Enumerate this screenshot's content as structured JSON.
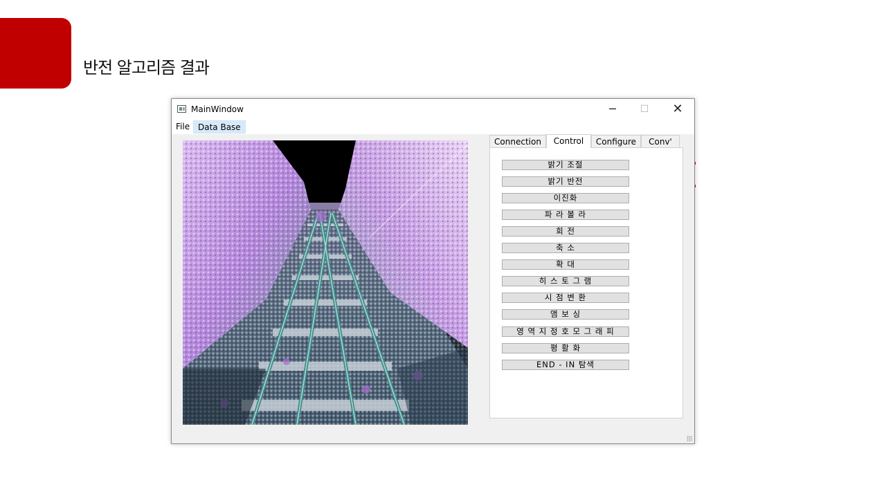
{
  "slide": {
    "title": "반전 알고리즘 결과",
    "accent_color": "#c00000"
  },
  "window": {
    "title": "MainWindow",
    "icon": "app-window-icon",
    "controls": {
      "minimize": "─",
      "maximize": "☐",
      "close": "✕"
    }
  },
  "menu": {
    "file": "File",
    "database": "Data Base"
  },
  "tabs": [
    "Connection",
    "Control",
    "Configure",
    "Conv'"
  ],
  "active_tab": "Control",
  "control_buttons": [
    "밝기 조절",
    "밝기 반전",
    "이진화",
    "파 라 볼 라",
    "회 전",
    "축 소",
    "확 대",
    "히 스 토 그 램",
    "시 점 변 환",
    "앰 보 싱",
    "영 역 지 정 호 모 그 래 피",
    "평 활 화",
    "END - IN 탐색"
  ]
}
